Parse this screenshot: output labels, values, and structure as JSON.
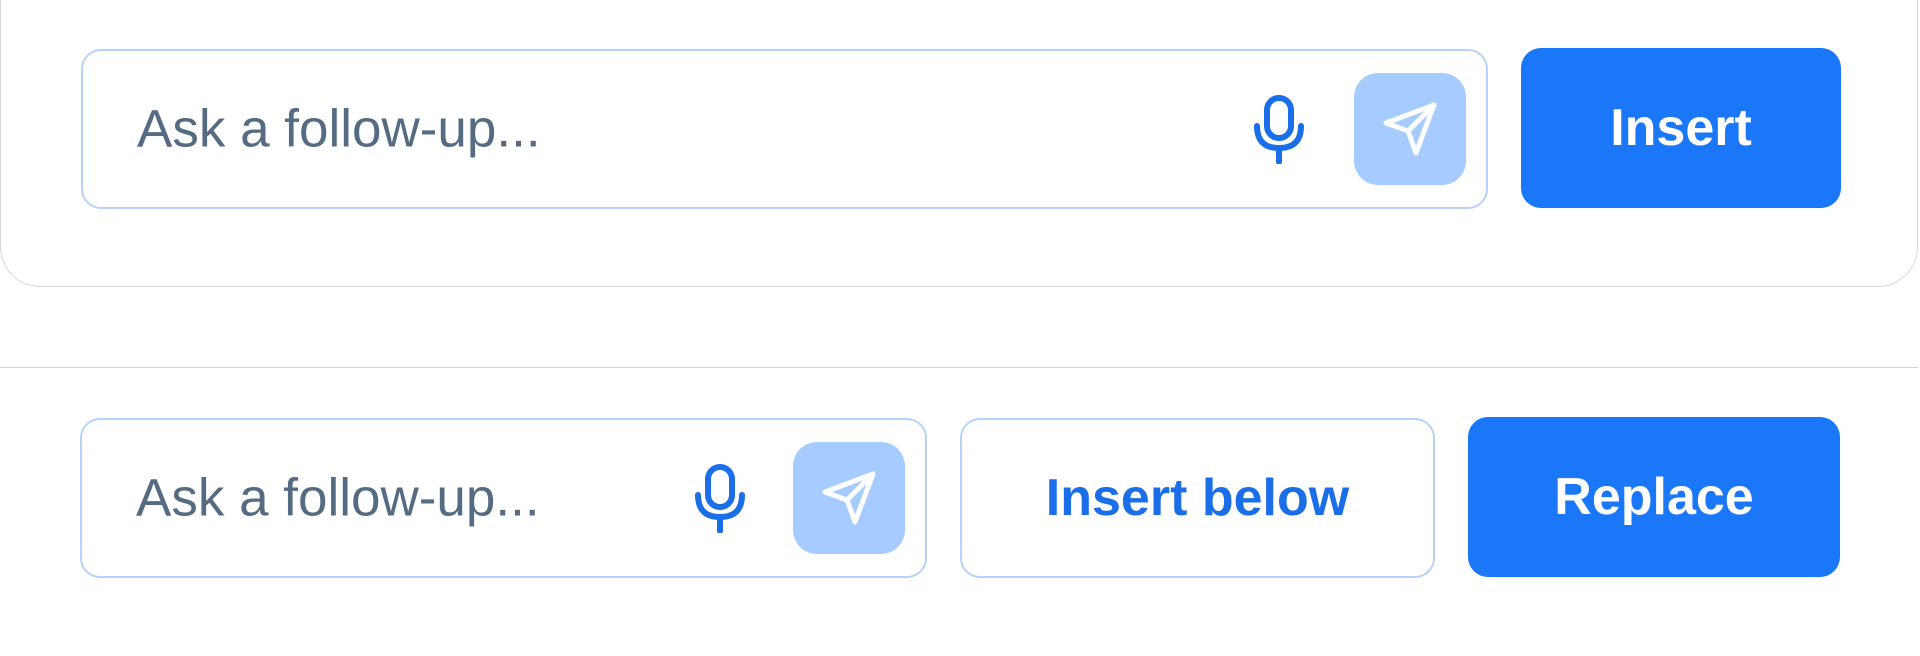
{
  "top_row": {
    "input_placeholder": "Ask a follow-up...",
    "insert_label": "Insert"
  },
  "bottom_row": {
    "input_placeholder": "Ask a follow-up...",
    "insert_below_label": "Insert below",
    "replace_label": "Replace"
  },
  "icons": {
    "mic": "microphone-icon",
    "send": "send-icon"
  },
  "colors": {
    "primary": "#1a77f8",
    "input_border": "#b6d3f7",
    "send_disabled": "#a5cbff",
    "placeholder": "#556b82"
  }
}
